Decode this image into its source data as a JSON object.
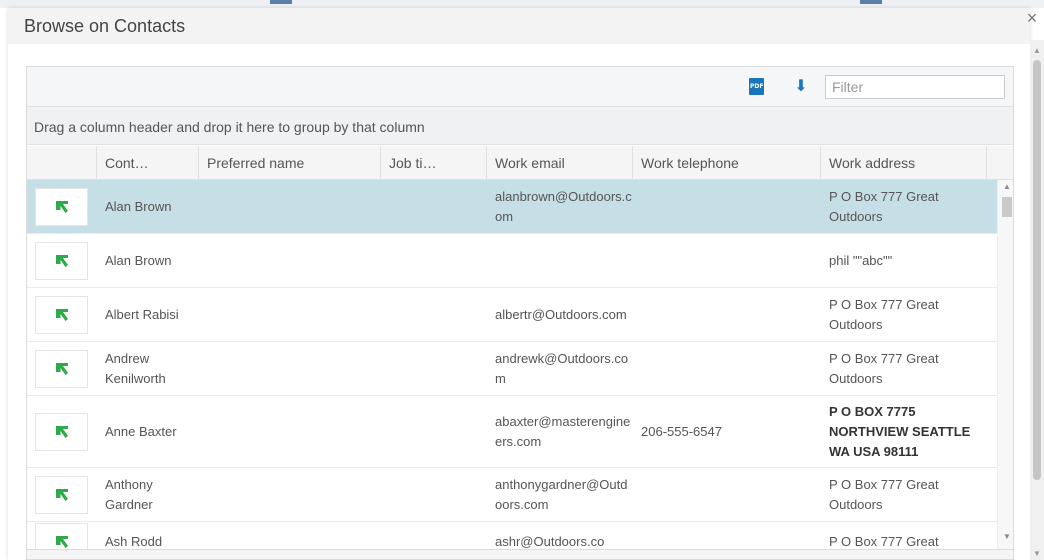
{
  "dialog": {
    "title": "Browse on Contacts",
    "close_label": "×"
  },
  "toolbar": {
    "pdf_label": "PDF",
    "download_label": "⬇",
    "filter_placeholder": "Filter"
  },
  "group_bar_text": "Drag a column header and drop it here to group by that column",
  "columns": [
    "Cont…",
    "Preferred name",
    "Job ti…",
    "Work email",
    "Work telephone",
    "Work address"
  ],
  "rows": [
    {
      "name": "Alan Brown",
      "preferred": "",
      "job": "",
      "email": "alanbrown@Outdoors.com",
      "phone": "",
      "address": "P O Box 777 Great Outdoors",
      "selected": true
    },
    {
      "name": "Alan Brown",
      "preferred": "",
      "job": "",
      "email": "",
      "phone": "",
      "address": "phil \"\"abc\"\""
    },
    {
      "name": "Albert Rabisi",
      "preferred": "",
      "job": "",
      "email": "albertr@Outdoors.com",
      "phone": "",
      "address": "P O Box 777 Great Outdoors"
    },
    {
      "name": "Andrew Kenilworth",
      "preferred": "",
      "job": "",
      "email": "andrewk@Outdoors.com",
      "phone": "",
      "address": "P O Box 777 Great Outdoors"
    },
    {
      "name": "Anne Baxter",
      "preferred": "",
      "job": "",
      "email": "abaxter@masterengineers.com",
      "phone": "206-555-6547",
      "address": "P O BOX 7775 NORTHVIEW SEATTLE WA USA 98111",
      "address_bold": true
    },
    {
      "name": "Anthony Gardner",
      "preferred": "",
      "job": "",
      "email": "anthonygardner@Outdoors.com",
      "phone": "",
      "address": "P O Box 777 Great Outdoors"
    },
    {
      "name": "Ash Rodd",
      "preferred": "",
      "job": "",
      "email": "ashr@Outdoors.co",
      "phone": "",
      "address": "P O Box 777 Great"
    }
  ],
  "colors": {
    "selected_row": "#c6dfe6",
    "icon_green": "#2eaa4a",
    "accent": "#1a75bb"
  },
  "icon_names": {
    "row_icon": "select-arrow-icon",
    "pdf": "pdf-icon",
    "download": "download-icon"
  }
}
